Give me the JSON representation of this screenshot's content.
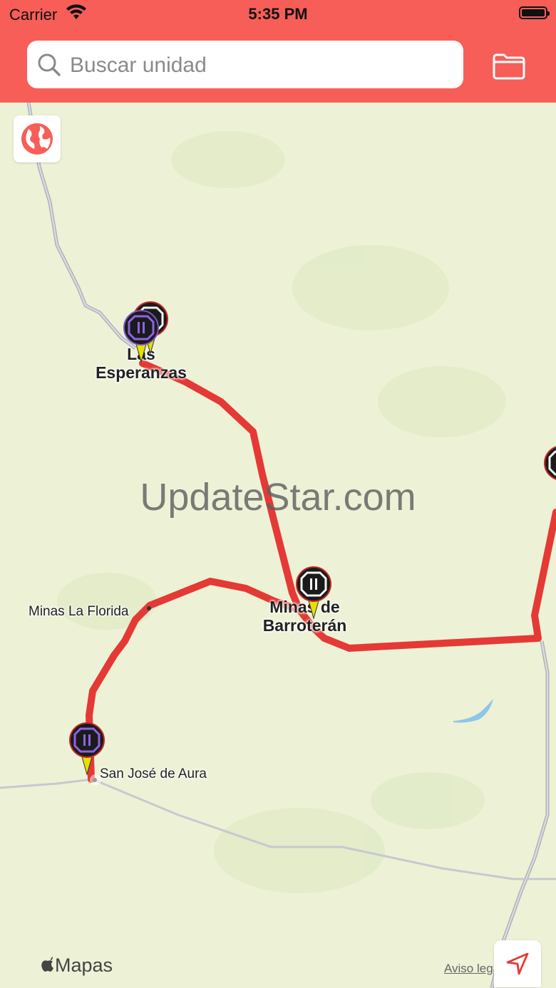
{
  "status": {
    "carrier": "Carrier",
    "time": "5:35 PM"
  },
  "search": {
    "placeholder": "Buscar unidad"
  },
  "map": {
    "watermark": "UpdateStar.com",
    "places": {
      "esperanzas_1": "Las",
      "esperanzas_2": "Esperanzas",
      "barroteran_1": "Minas de",
      "barroteran_2": "Barroterán",
      "florida": "Minas La Florida",
      "aura": "San José de Aura"
    },
    "attribution": "Mapas",
    "legal": "Aviso legal"
  },
  "colors": {
    "accent": "#f65e57",
    "route": "#e53935",
    "pin_pointer": "#e8e000"
  },
  "icons": {
    "search": "search-icon",
    "folder": "folder-icon",
    "globe": "globe-icon",
    "locate": "location-arrow-icon",
    "pin": "vehicle-pin-icon"
  }
}
